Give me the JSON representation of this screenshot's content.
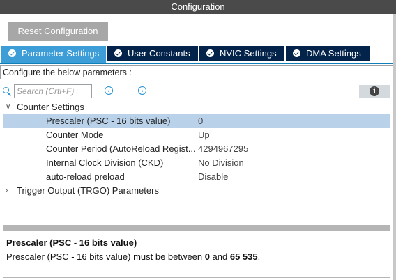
{
  "window": {
    "title": "Configuration"
  },
  "toolbar": {
    "reset_label": "Reset Configuration"
  },
  "tabs": [
    {
      "label": "Parameter Settings",
      "active": true,
      "icon": "check-circle-icon"
    },
    {
      "label": "User Constants",
      "active": false,
      "icon": "check-circle-icon"
    },
    {
      "label": "NVIC Settings",
      "active": false,
      "icon": "check-circle-icon"
    },
    {
      "label": "DMA Settings",
      "active": false,
      "icon": "check-circle-icon"
    }
  ],
  "config_label": "Configure the below parameters :",
  "search": {
    "placeholder": "Search (Crtl+F)",
    "value": ""
  },
  "groups": {
    "counter_settings": {
      "label": "Counter Settings",
      "expanded": true,
      "params": [
        {
          "name": "Prescaler (PSC - 16 bits value)",
          "value": "0",
          "selected": true
        },
        {
          "name": "Counter Mode",
          "value": "Up",
          "selected": false
        },
        {
          "name": "Counter Period (AutoReload Regist...",
          "value": "4294967295",
          "selected": false
        },
        {
          "name": "Internal Clock Division (CKD)",
          "value": "No Division",
          "selected": false
        },
        {
          "name": "auto-reload preload",
          "value": "Disable",
          "selected": false
        }
      ]
    },
    "trigger_output": {
      "label": "Trigger Output (TRGO) Parameters",
      "expanded": false
    }
  },
  "description": {
    "title": "Prescaler (PSC - 16 bits value)",
    "text_prefix": "Prescaler (PSC - 16 bits value) must be between ",
    "min": "0",
    "and_word": " and ",
    "max": "65 535",
    "suffix": "."
  },
  "colors": {
    "active_tab": "#3c9dd7",
    "inactive_tab": "#03234b",
    "selected_row": "#b9d2ea",
    "titlebar": "#4a4a4a"
  }
}
